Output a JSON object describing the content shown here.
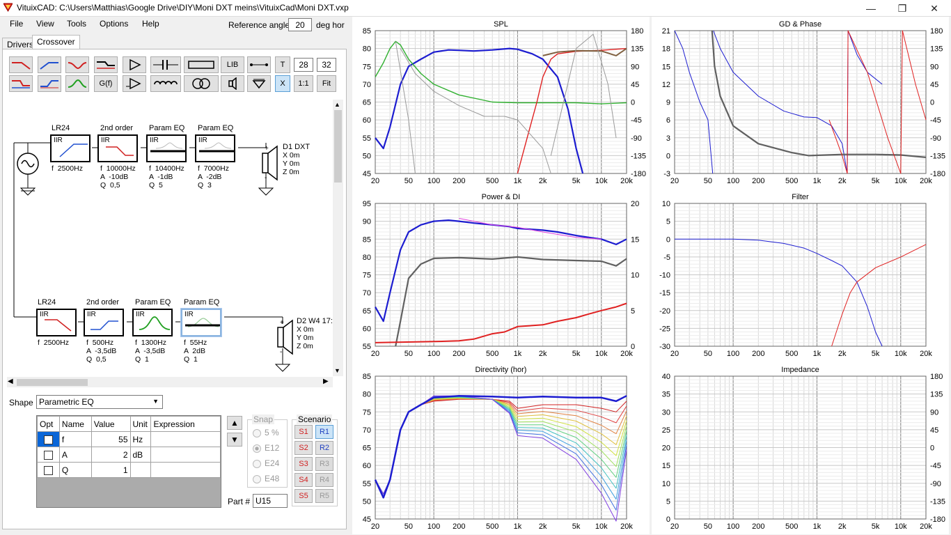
{
  "window": {
    "title": "VituixCAD: C:\\Users\\Matthias\\Google Drive\\DIY\\Moni DXT meins\\VituixCad\\Moni DXT.vxp"
  },
  "menu": {
    "file": "File",
    "view": "View",
    "tools": "Tools",
    "options": "Options",
    "help": "Help"
  },
  "reference": {
    "label": "Reference angle",
    "value": "20",
    "unit": "deg hor"
  },
  "tabs": {
    "drivers": "Drivers",
    "crossover": "Crossover"
  },
  "toolbar": {
    "lib": "LIB",
    "t": "T",
    "n1": "28",
    "n2": "32",
    "gf": "G(f)",
    "x": "X",
    "ratio": "1:1",
    "fit": "Fit"
  },
  "schematic": {
    "top_blocks": [
      {
        "title": "LR24",
        "type": "IIR",
        "params": "f  2500Hz"
      },
      {
        "title": "2nd order",
        "type": "IIR",
        "params": "f  10000Hz\nA  -10dB\nQ  0,5"
      },
      {
        "title": "Param EQ",
        "type": "IIR",
        "params": "f  10400Hz\nA  -1dB\nQ  5"
      },
      {
        "title": "Param EQ",
        "type": "IIR",
        "params": "f  7000Hz\nA  -2dB\nQ  3"
      }
    ],
    "bottom_blocks": [
      {
        "title": "LR24",
        "type": "IIR",
        "params": "f  2500Hz"
      },
      {
        "title": "2nd order",
        "type": "IIR",
        "params": "f  500Hz\nA  -3,5dB\nQ  0,5"
      },
      {
        "title": "Param EQ",
        "type": "IIR",
        "params": "f  1300Hz\nA  -3,5dB\nQ  1"
      },
      {
        "title": "Param EQ",
        "type": "IIR",
        "params": "f  55Hz\nA  2dB\nQ  1"
      }
    ],
    "driver1": {
      "name": "D1 DXT",
      "x": "X 0m",
      "y": "Y 0m",
      "z": "Z 0m"
    },
    "driver2": {
      "name": "D2 W4 17:",
      "x": "X 0m",
      "y": "Y 0m",
      "z": "Z 0m"
    }
  },
  "shape": {
    "label": "Shape",
    "value": "Parametric EQ"
  },
  "param_table": {
    "headers": [
      "Opt",
      "Name",
      "Value",
      "Unit",
      "Expression"
    ],
    "rows": [
      {
        "name": "f",
        "value": "55",
        "unit": "Hz",
        "expression": ""
      },
      {
        "name": "A",
        "value": "2",
        "unit": "dB",
        "expression": ""
      },
      {
        "name": "Q",
        "value": "1",
        "unit": "",
        "expression": ""
      }
    ]
  },
  "snap": {
    "title": "Snap",
    "options": [
      "5 %",
      "E12",
      "E24",
      "E48"
    ],
    "selected": "E12"
  },
  "part": {
    "label": "Part #",
    "value": "U15"
  },
  "scenario": {
    "title": "Scenario",
    "s": [
      "S1",
      "S2",
      "S3",
      "S4",
      "S5"
    ],
    "r": [
      "R1",
      "R2",
      "R3",
      "R4",
      "R5"
    ]
  },
  "charts": {
    "spl": {
      "title": "SPL",
      "yleft": [
        "85",
        "80",
        "75",
        "70",
        "65",
        "60",
        "55",
        "50",
        "45"
      ],
      "yright": [
        "180",
        "135",
        "90",
        "45",
        "0",
        "-45",
        "-90",
        "-135",
        "-180"
      ]
    },
    "gd": {
      "title": "GD & Phase",
      "yleft": [
        "21",
        "18",
        "15",
        "12",
        "9",
        "6",
        "3",
        "0",
        "-3"
      ],
      "yright": [
        "180",
        "135",
        "90",
        "45",
        "0",
        "-45",
        "-90",
        "-135",
        "-180"
      ]
    },
    "power": {
      "title": "Power & DI",
      "yleft": [
        "95",
        "90",
        "85",
        "80",
        "75",
        "70",
        "65",
        "60",
        "55"
      ],
      "yright": [
        "20",
        "15",
        "10",
        "5",
        "0"
      ]
    },
    "filter": {
      "title": "Filter",
      "yleft": [
        "10",
        "5",
        "0",
        "-5",
        "-10",
        "-15",
        "-20",
        "-25",
        "-30"
      ],
      "yright": []
    },
    "directivity": {
      "title": "Directivity (hor)",
      "yleft": [
        "85",
        "80",
        "75",
        "70",
        "65",
        "60",
        "55",
        "50",
        "45"
      ],
      "yright": []
    },
    "impedance": {
      "title": "Impedance",
      "yleft": [
        "40",
        "35",
        "30",
        "25",
        "20",
        "15",
        "10",
        "5",
        "0"
      ],
      "yright": [
        "180",
        "135",
        "90",
        "45",
        "0",
        "-45",
        "-90",
        "-135",
        "-180"
      ]
    },
    "xticks": [
      "20",
      "50",
      "100",
      "200",
      "500",
      "1k",
      "2k",
      "5k",
      "10k",
      "20k"
    ]
  },
  "colors": {
    "blue": "#1c1cd0",
    "red": "#e02020",
    "green": "#30b030",
    "gray": "#606060",
    "magenta": "#e040e0"
  }
}
